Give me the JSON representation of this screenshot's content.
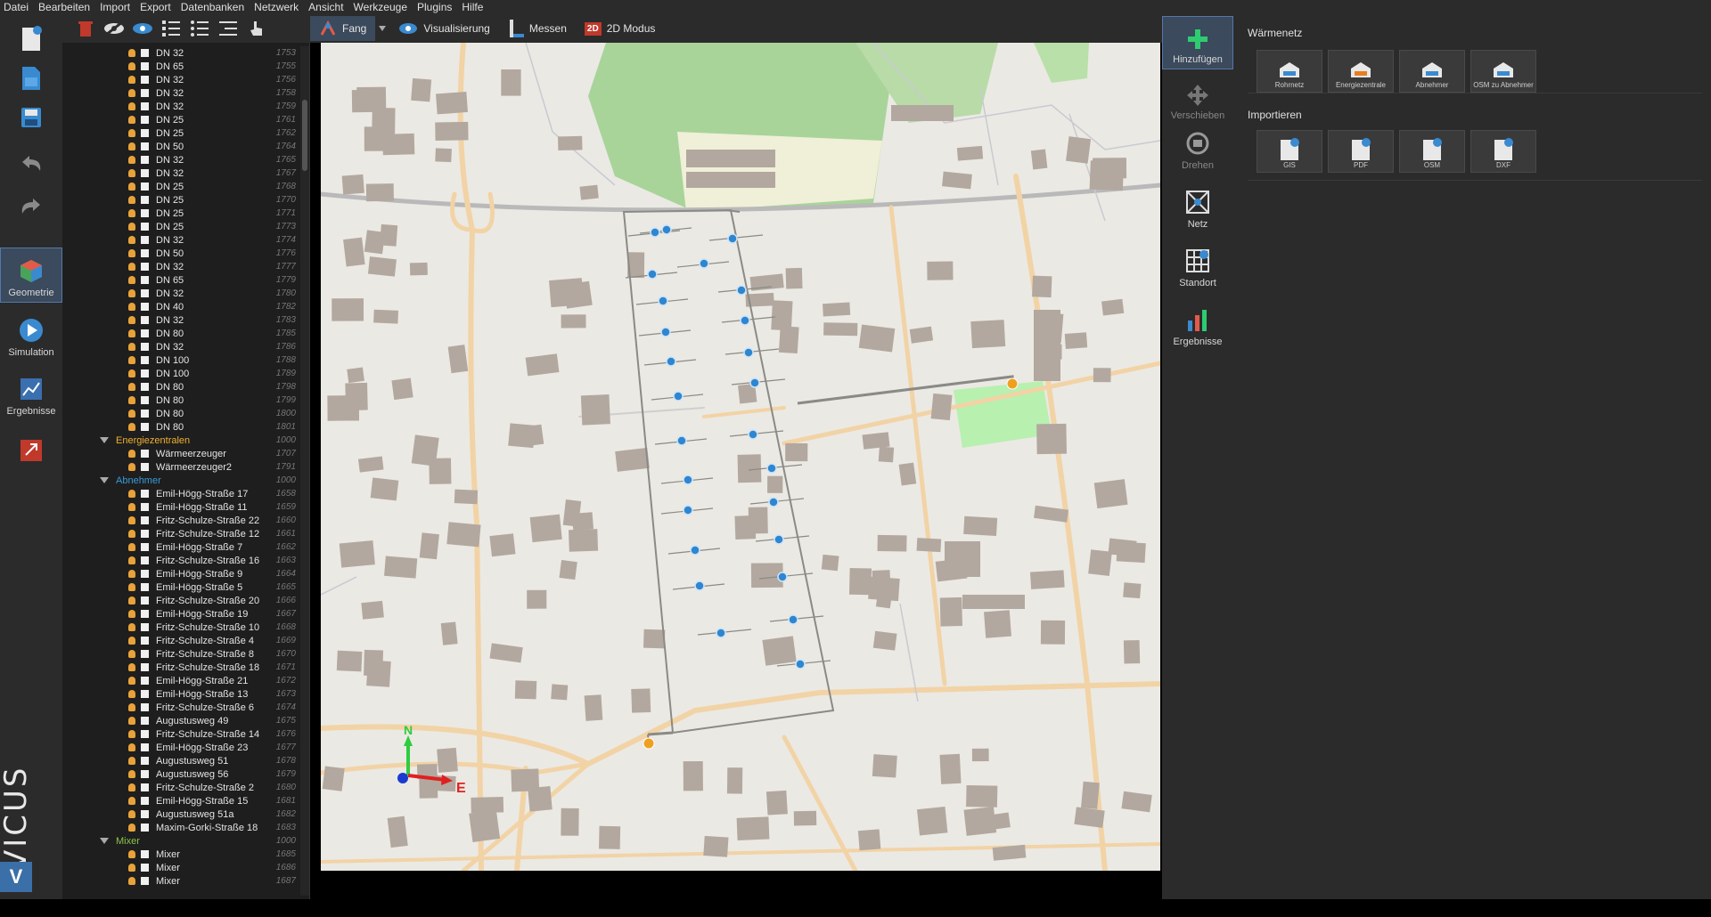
{
  "menu": [
    "Datei",
    "Bearbeiten",
    "Import",
    "Export",
    "Datenbanken",
    "Netzwerk",
    "Ansicht",
    "Werkzeuge",
    "Plugins",
    "Hilfe"
  ],
  "rail": {
    "nav": [
      {
        "label": "Geometrie",
        "active": true
      },
      {
        "label": "Simulation",
        "active": false
      },
      {
        "label": "Ergebnisse",
        "active": false
      }
    ],
    "brand": "VICUS",
    "brand_mark": "V"
  },
  "toolbar": {
    "fang": "Fang",
    "visualisierung": "Visualisierung",
    "messen": "Messen",
    "modus_badge": "2D",
    "modus": "2D Modus"
  },
  "tree": {
    "pipes": [
      {
        "name": "DN 32",
        "id": "1753"
      },
      {
        "name": "DN 65",
        "id": "1755"
      },
      {
        "name": "DN 32",
        "id": "1756"
      },
      {
        "name": "DN 32",
        "id": "1758"
      },
      {
        "name": "DN 32",
        "id": "1759"
      },
      {
        "name": "DN 25",
        "id": "1761"
      },
      {
        "name": "DN 25",
        "id": "1762"
      },
      {
        "name": "DN 50",
        "id": "1764"
      },
      {
        "name": "DN 32",
        "id": "1765"
      },
      {
        "name": "DN 32",
        "id": "1767"
      },
      {
        "name": "DN 25",
        "id": "1768"
      },
      {
        "name": "DN 25",
        "id": "1770"
      },
      {
        "name": "DN 25",
        "id": "1771"
      },
      {
        "name": "DN 25",
        "id": "1773"
      },
      {
        "name": "DN 32",
        "id": "1774"
      },
      {
        "name": "DN 50",
        "id": "1776"
      },
      {
        "name": "DN 32",
        "id": "1777"
      },
      {
        "name": "DN 65",
        "id": "1779"
      },
      {
        "name": "DN 32",
        "id": "1780"
      },
      {
        "name": "DN 40",
        "id": "1782"
      },
      {
        "name": "DN 32",
        "id": "1783"
      },
      {
        "name": "DN 80",
        "id": "1785"
      },
      {
        "name": "DN 32",
        "id": "1786"
      },
      {
        "name": "DN 100",
        "id": "1788"
      },
      {
        "name": "DN 100",
        "id": "1789"
      },
      {
        "name": "DN 80",
        "id": "1798"
      },
      {
        "name": "DN 80",
        "id": "1799"
      },
      {
        "name": "DN 80",
        "id": "1800"
      },
      {
        "name": "DN 80",
        "id": "1801"
      }
    ],
    "groups": [
      {
        "name": "Energiezentralen",
        "id": "1000",
        "color": "#f0b030",
        "items": [
          {
            "name": "Wärmeerzeuger",
            "id": "1707"
          },
          {
            "name": "Wärmeerzeuger2",
            "id": "1791"
          }
        ]
      },
      {
        "name": "Abnehmer",
        "id": "1000",
        "color": "#3a9ad9",
        "items": [
          {
            "name": "Emil-Högg-Straße 17",
            "id": "1658"
          },
          {
            "name": "Emil-Högg-Straße 11",
            "id": "1659"
          },
          {
            "name": "Fritz-Schulze-Straße 22",
            "id": "1660"
          },
          {
            "name": "Fritz-Schulze-Straße 12",
            "id": "1661"
          },
          {
            "name": "Emil-Högg-Straße 7",
            "id": "1662"
          },
          {
            "name": "Fritz-Schulze-Straße 16",
            "id": "1663"
          },
          {
            "name": "Emil-Högg-Straße 9",
            "id": "1664"
          },
          {
            "name": "Emil-Högg-Straße 5",
            "id": "1665"
          },
          {
            "name": "Fritz-Schulze-Straße 20",
            "id": "1666"
          },
          {
            "name": "Emil-Högg-Straße 19",
            "id": "1667"
          },
          {
            "name": "Fritz-Schulze-Straße 10",
            "id": "1668"
          },
          {
            "name": "Fritz-Schulze-Straße 4",
            "id": "1669"
          },
          {
            "name": "Fritz-Schulze-Straße 8",
            "id": "1670"
          },
          {
            "name": "Fritz-Schulze-Straße 18",
            "id": "1671"
          },
          {
            "name": "Emil-Högg-Straße 21",
            "id": "1672"
          },
          {
            "name": "Emil-Högg-Straße 13",
            "id": "1673"
          },
          {
            "name": "Fritz-Schulze-Straße 6",
            "id": "1674"
          },
          {
            "name": "Augustusweg 49",
            "id": "1675"
          },
          {
            "name": "Fritz-Schulze-Straße 14",
            "id": "1676"
          },
          {
            "name": "Emil-Högg-Straße 23",
            "id": "1677"
          },
          {
            "name": "Augustusweg 51",
            "id": "1678"
          },
          {
            "name": "Augustusweg 56",
            "id": "1679"
          },
          {
            "name": "Fritz-Schulze-Straße 2",
            "id": "1680"
          },
          {
            "name": "Emil-Högg-Straße 15",
            "id": "1681"
          },
          {
            "name": "Augustusweg 51a",
            "id": "1682"
          },
          {
            "name": "Maxim-Gorki-Straße 18",
            "id": "1683"
          }
        ]
      },
      {
        "name": "Mixer",
        "id": "1000",
        "color": "#8bc34a",
        "items": [
          {
            "name": "Mixer",
            "id": "1685"
          },
          {
            "name": "Mixer",
            "id": "1686"
          },
          {
            "name": "Mixer",
            "id": "1687"
          }
        ]
      }
    ]
  },
  "map": {
    "compass_n": "N",
    "compass_e": "E",
    "colors": {
      "ground": "#ebe9e3",
      "building": "#b2a89f",
      "road": "#f2d3a6",
      "forest": "#a8d49a",
      "pipe": "#8a8a86",
      "consumer": "#2f86d0",
      "source": "#f0a020"
    }
  },
  "ribbon": {
    "nav": [
      {
        "label": "Hinzufügen",
        "state": "active"
      },
      {
        "label": "Verschieben",
        "state": "dim"
      },
      {
        "label": "Drehen",
        "state": "dim"
      },
      {
        "label": "Netz",
        "state": "normal"
      },
      {
        "label": "Standort",
        "state": "normal"
      },
      {
        "label": "Ergebnisse",
        "state": "normal"
      }
    ],
    "waermenetz_title": "Wärmenetz",
    "waermenetz_tiles": [
      "Rohrnetz",
      "Energiezentrale",
      "Abnehmer",
      "OSM zu Abnehmer"
    ],
    "import_title": "Importieren",
    "import_tiles": [
      "GIS",
      "PDF",
      "OSM",
      "DXF"
    ]
  }
}
